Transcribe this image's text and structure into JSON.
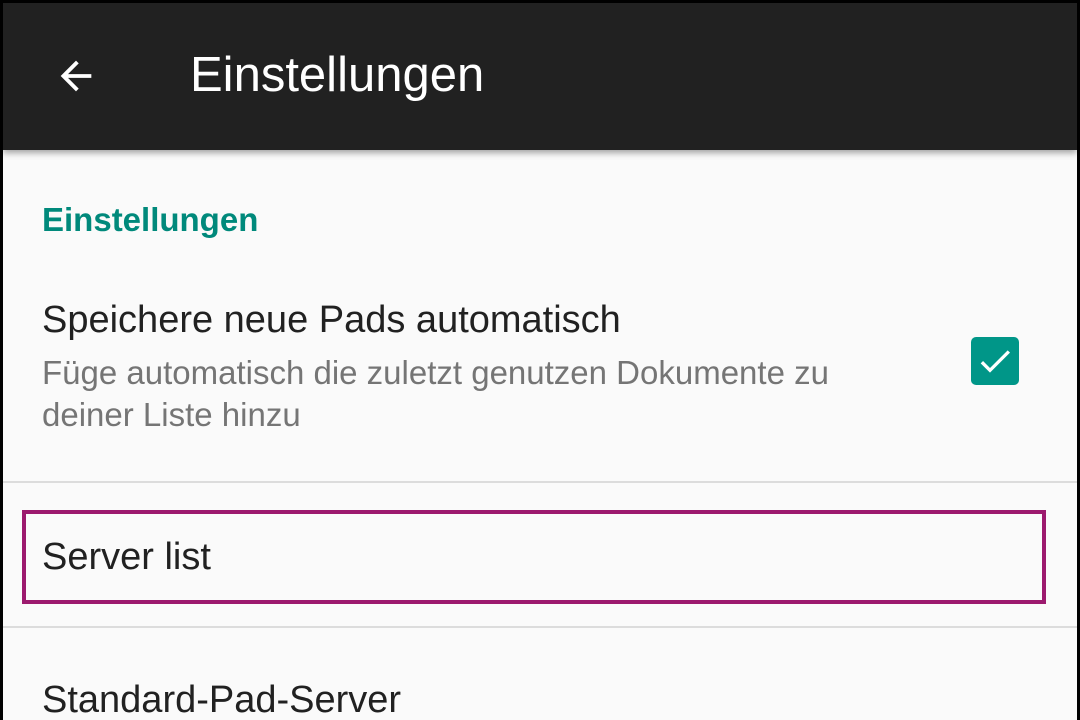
{
  "toolbar": {
    "back_icon": "arrow-back-icon",
    "title": "Einstellungen"
  },
  "settings": {
    "category_title": "Einstellungen",
    "autosave": {
      "title": "Speichere neue Pads automatisch",
      "summary": "Füge automatisch die zuletzt genutzen Dokumente zu deiner Liste hinzu",
      "checked": true,
      "check_icon": "check-icon"
    },
    "server_list": {
      "title": "Server list"
    },
    "default_server": {
      "title": "Standard-Pad-Server"
    }
  },
  "colors": {
    "appbar": "#212121",
    "accent": "#009688",
    "category_text": "#00897b",
    "highlight_border": "#9c1a6e",
    "background": "#fafafa"
  }
}
